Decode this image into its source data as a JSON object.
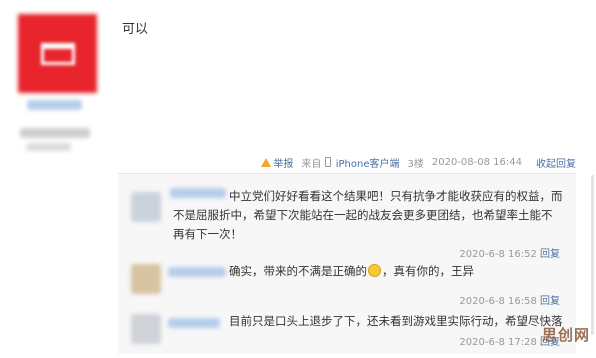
{
  "post": {
    "text": "可以"
  },
  "meta": {
    "report": "举报",
    "source_prefix": "来自",
    "source_link": "iPhone客户端",
    "floor": "3楼",
    "timestamp": "2020-08-08 16:44",
    "collapse": "收起回复"
  },
  "replies": [
    {
      "text": "中立党们好好看看这个结果吧！只有抗争才能收获应有的权益，而不是屈服折中，希望下次能站在一起的战友会更多更团结，也希望率土能不再有下一次！",
      "time": "2020-6-8 16:52",
      "reply_label": "回复"
    },
    {
      "text_before": "确实，带来的不满是正确的",
      "text_after": "，真有你的，王异",
      "time": "2020-6-8 16:58",
      "reply_label": "回复"
    },
    {
      "text": "目前只是口头上退步了下，还未看到游戏里实际行动，希望尽快落实",
      "time": "2020-6-8 17:28",
      "reply_label": "回复"
    }
  ],
  "watermark": "思创网",
  "colors": {
    "link": "#4b6fa5",
    "avatar": "#e8242c",
    "reply_bg": "#f7f7f7"
  }
}
